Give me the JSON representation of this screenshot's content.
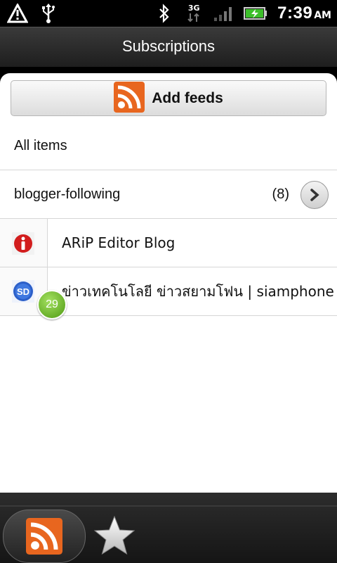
{
  "status_bar": {
    "time": "7:39",
    "ampm": "AM",
    "network": "3G",
    "icons": [
      "warning-icon",
      "usb-icon",
      "bluetooth-icon",
      "signal-icon",
      "battery-icon"
    ]
  },
  "header": {
    "title": "Subscriptions"
  },
  "actions": {
    "add_feeds_label": "Add feeds"
  },
  "list": {
    "all_items_label": "All items",
    "folder": {
      "label": "blogger-following",
      "count": "(8)"
    },
    "feeds": [
      {
        "title": "ARiP Editor Blog",
        "icon": "arip-logo-icon"
      },
      {
        "title": "ข่าวเทคโนโลยี ข่าวสยามโฟน | siamphone",
        "icon": "siamphone-logo-icon",
        "unread": "29"
      }
    ]
  },
  "bottom_tabs": [
    {
      "name": "subscriptions",
      "icon": "rss-icon",
      "selected": true
    },
    {
      "name": "starred",
      "icon": "star-icon",
      "selected": false
    }
  ],
  "colors": {
    "rss_orange": "#e8661f",
    "badge_green": "#5aa81e",
    "panel_bg": "#ffffff"
  }
}
